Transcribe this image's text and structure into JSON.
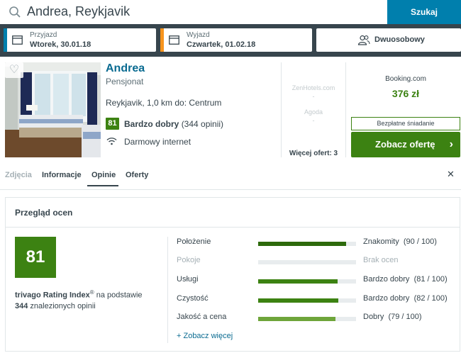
{
  "search": {
    "query": "Andrea, Reykjavik",
    "button_label": "Szukaj"
  },
  "dates": {
    "checkin_label": "Przyjazd",
    "checkin_value": "Wtorek, 30.01.18",
    "checkout_label": "Wyjazd",
    "checkout_value": "Czwartek, 01.02.18",
    "room_type": "Dwuosobowy"
  },
  "hotel": {
    "name": "Andrea",
    "type": "Pensjonat",
    "location": "Reykjavik, 1,0 km do: Centrum",
    "rating_score": "81",
    "rating_label": "Bardzo dobry",
    "rating_count": "(344 opinii)",
    "amenity": "Darmowy internet"
  },
  "other_offers": {
    "provider1": "ZenHotels.com",
    "provider1_price": "-",
    "provider2": "Agoda",
    "provider2_price": "-",
    "more_label": "Więcej ofert: 3"
  },
  "deal": {
    "site": "Booking.com",
    "price": "376 zł",
    "perk": "Bezpłatne śniadanie",
    "cta_label": "Zobacz ofertę",
    "cta_chevron": "›"
  },
  "tabs": [
    {
      "label": "Zdjęcia",
      "state": "disabled"
    },
    {
      "label": "Informacje",
      "state": "normal"
    },
    {
      "label": "Opinie",
      "state": "active"
    },
    {
      "label": "Oferty",
      "state": "normal"
    }
  ],
  "close_icon": "✕",
  "review": {
    "title": "Przegląd ocen",
    "score": "81",
    "index_name": "trivago Rating Index",
    "index_sup": "®",
    "index_rest": " na podstawie",
    "count": "344",
    "count_rest": " znalezionych opinii",
    "categories": [
      {
        "name": "Położenie",
        "verdict": "Znakomity",
        "score": "(90 / 100)",
        "value": 90,
        "color": "#2d6a0c"
      },
      {
        "name": "Pokoje",
        "verdict": "Brak ocen",
        "score": "",
        "value": 0,
        "color": "#e8ecee"
      },
      {
        "name": "Usługi",
        "verdict": "Bardzo dobry",
        "score": "(81 / 100)",
        "value": 81,
        "color": "#3c8212"
      },
      {
        "name": "Czystość",
        "verdict": "Bardzo dobry",
        "score": "(82 / 100)",
        "value": 82,
        "color": "#3c8212"
      },
      {
        "name": "Jakość a cena",
        "verdict": "Dobry",
        "score": "(79 / 100)",
        "value": 79,
        "color": "#6ea53a"
      }
    ],
    "see_more": "+ Zobacz więcej"
  },
  "colors": {
    "brand_blue": "#007fad",
    "rating_green": "#3c8212",
    "checkin_stripe": "#007fad",
    "checkout_stripe": "#f7941d"
  }
}
